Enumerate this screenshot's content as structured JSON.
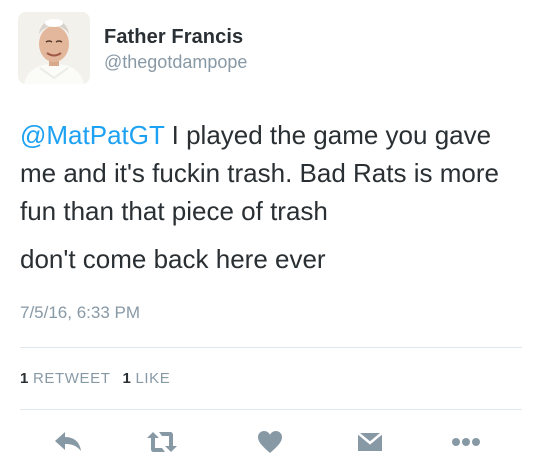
{
  "user": {
    "display_name": "Father Francis",
    "handle": "@thegotdampope",
    "avatar_icon": "profile-avatar"
  },
  "tweet": {
    "mention": "@MatPatGT",
    "line_1_rest": " I played the game you gave me and it's fuckin trash. Bad Rats is more fun than that piece of trash",
    "line_2": "don't come back here ever",
    "timestamp": "7/5/16, 6:33 PM"
  },
  "stats": {
    "retweet_count": "1",
    "retweet_label": "RETWEET",
    "like_count": "1",
    "like_label": "LIKE"
  },
  "actions": [
    "reply-icon",
    "retweet-icon",
    "like-icon",
    "direct-message-icon",
    "more-icon"
  ],
  "colors": {
    "text": "#292f33",
    "secondary": "#8899a6",
    "link": "#1da1f2",
    "icon": "#8899a6",
    "divider": "#e1e8ed"
  }
}
